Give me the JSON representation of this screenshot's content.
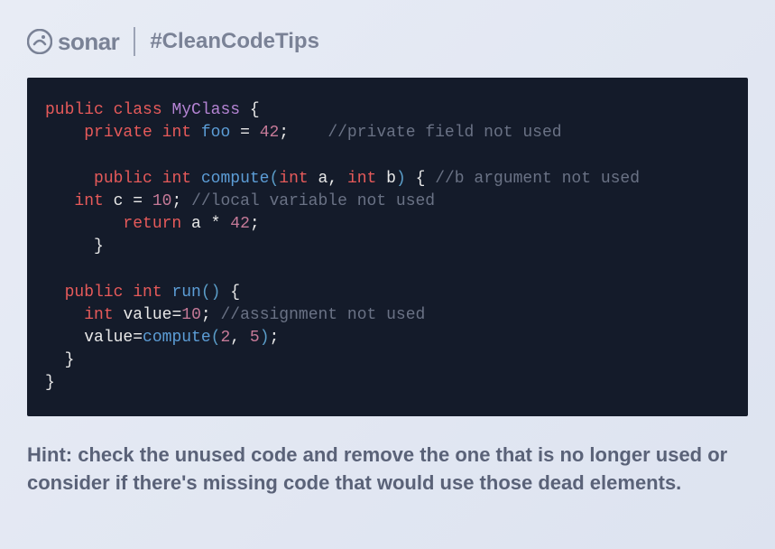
{
  "header": {
    "brand": "sonar",
    "hashtag": "#CleanCodeTips"
  },
  "code": {
    "lines": [
      {
        "indent": 0,
        "tokens": [
          {
            "t": "public ",
            "c": "kw-red"
          },
          {
            "t": "class ",
            "c": "kw-red"
          },
          {
            "t": "MyClass ",
            "c": "kw-purple"
          },
          {
            "t": "{",
            "c": "kw-white"
          }
        ]
      },
      {
        "indent": 1,
        "tokens": [
          {
            "t": "private ",
            "c": "kw-red"
          },
          {
            "t": "int ",
            "c": "kw-red"
          },
          {
            "t": "foo ",
            "c": "kw-blue"
          },
          {
            "t": "= ",
            "c": "kw-white"
          },
          {
            "t": "42",
            "c": "num"
          },
          {
            "t": ";    ",
            "c": "kw-white"
          },
          {
            "t": "//private field not used",
            "c": "comment"
          }
        ]
      },
      {
        "indent": 0,
        "tokens": [
          {
            "t": " ",
            "c": "kw-white"
          }
        ]
      },
      {
        "indent": 1,
        "tokens": [
          {
            "t": " public ",
            "c": "kw-red"
          },
          {
            "t": "int ",
            "c": "kw-red"
          },
          {
            "t": "compute",
            "c": "kw-blue"
          },
          {
            "t": "(",
            "c": "paren"
          },
          {
            "t": "int ",
            "c": "kw-red"
          },
          {
            "t": "a",
            "c": "kw-white"
          },
          {
            "t": ", ",
            "c": "kw-white"
          },
          {
            "t": "int ",
            "c": "kw-red"
          },
          {
            "t": "b",
            "c": "kw-white"
          },
          {
            "t": ") ",
            "c": "paren"
          },
          {
            "t": "{ ",
            "c": "kw-white"
          },
          {
            "t": "//b argument not used",
            "c": "comment"
          }
        ]
      },
      {
        "indent": 0,
        "tokens": [
          {
            "t": "   int ",
            "c": "kw-red"
          },
          {
            "t": "c ",
            "c": "kw-white"
          },
          {
            "t": "= ",
            "c": "kw-white"
          },
          {
            "t": "10",
            "c": "num"
          },
          {
            "t": "; ",
            "c": "kw-white"
          },
          {
            "t": "//local variable not used",
            "c": "comment"
          }
        ]
      },
      {
        "indent": 2,
        "tokens": [
          {
            "t": "return ",
            "c": "kw-red"
          },
          {
            "t": "a ",
            "c": "kw-white"
          },
          {
            "t": "* ",
            "c": "kw-white"
          },
          {
            "t": "42",
            "c": "num"
          },
          {
            "t": ";",
            "c": "kw-white"
          }
        ]
      },
      {
        "indent": 1,
        "tokens": [
          {
            "t": " }",
            "c": "kw-white"
          }
        ]
      },
      {
        "indent": 0,
        "tokens": [
          {
            "t": " ",
            "c": "kw-white"
          }
        ]
      },
      {
        "indent": 0,
        "tokens": [
          {
            "t": "  public ",
            "c": "kw-red"
          },
          {
            "t": "int ",
            "c": "kw-red"
          },
          {
            "t": "run",
            "c": "kw-blue"
          },
          {
            "t": "() ",
            "c": "paren"
          },
          {
            "t": "{",
            "c": "kw-white"
          }
        ]
      },
      {
        "indent": 1,
        "tokens": [
          {
            "t": "int ",
            "c": "kw-red"
          },
          {
            "t": "value",
            "c": "kw-white"
          },
          {
            "t": "=",
            "c": "kw-white"
          },
          {
            "t": "10",
            "c": "num"
          },
          {
            "t": "; ",
            "c": "kw-white"
          },
          {
            "t": "//assignment not used",
            "c": "comment"
          }
        ]
      },
      {
        "indent": 1,
        "tokens": [
          {
            "t": "value",
            "c": "kw-white"
          },
          {
            "t": "=",
            "c": "kw-white"
          },
          {
            "t": "compute",
            "c": "kw-blue"
          },
          {
            "t": "(",
            "c": "paren"
          },
          {
            "t": "2",
            "c": "num"
          },
          {
            "t": ", ",
            "c": "kw-white"
          },
          {
            "t": "5",
            "c": "num"
          },
          {
            "t": ")",
            "c": "paren"
          },
          {
            "t": ";",
            "c": "kw-white"
          }
        ]
      },
      {
        "indent": 0,
        "tokens": [
          {
            "t": "  }",
            "c": "kw-white"
          }
        ]
      },
      {
        "indent": 0,
        "tokens": [
          {
            "t": "}",
            "c": "kw-white"
          }
        ]
      }
    ]
  },
  "hint": "Hint: check the unused code and remove the one that is no longer used or consider if there's missing code that would use those dead elements."
}
